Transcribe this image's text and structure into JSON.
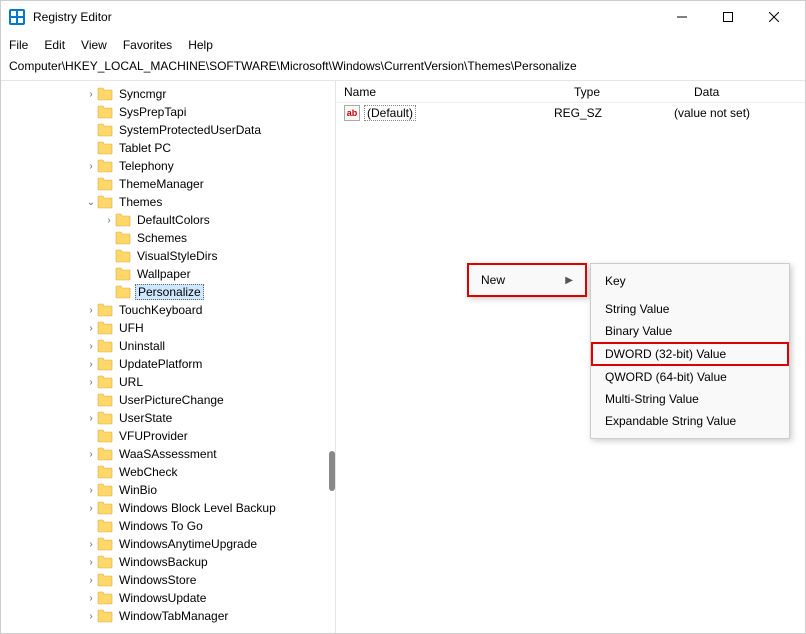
{
  "window": {
    "title": "Registry Editor"
  },
  "menubar": {
    "file": "File",
    "edit": "Edit",
    "view": "View",
    "favorites": "Favorites",
    "help": "Help"
  },
  "addressbar": "Computer\\HKEY_LOCAL_MACHINE\\SOFTWARE\\Microsoft\\Windows\\CurrentVersion\\Themes\\Personalize",
  "tree": [
    {
      "label": "Syncmgr",
      "depth": 5,
      "expand": ">"
    },
    {
      "label": "SysPrepTapi",
      "depth": 5,
      "expand": ""
    },
    {
      "label": "SystemProtectedUserData",
      "depth": 5,
      "expand": ""
    },
    {
      "label": "Tablet PC",
      "depth": 5,
      "expand": ""
    },
    {
      "label": "Telephony",
      "depth": 5,
      "expand": ">"
    },
    {
      "label": "ThemeManager",
      "depth": 5,
      "expand": ""
    },
    {
      "label": "Themes",
      "depth": 5,
      "expand": "v"
    },
    {
      "label": "DefaultColors",
      "depth": 6,
      "expand": ">"
    },
    {
      "label": "Schemes",
      "depth": 6,
      "expand": ""
    },
    {
      "label": "VisualStyleDirs",
      "depth": 6,
      "expand": ""
    },
    {
      "label": "Wallpaper",
      "depth": 6,
      "expand": ""
    },
    {
      "label": "Personalize",
      "depth": 6,
      "expand": "",
      "selected": true
    },
    {
      "label": "TouchKeyboard",
      "depth": 5,
      "expand": ">"
    },
    {
      "label": "UFH",
      "depth": 5,
      "expand": ">"
    },
    {
      "label": "Uninstall",
      "depth": 5,
      "expand": ">"
    },
    {
      "label": "UpdatePlatform",
      "depth": 5,
      "expand": ">"
    },
    {
      "label": "URL",
      "depth": 5,
      "expand": ">"
    },
    {
      "label": "UserPictureChange",
      "depth": 5,
      "expand": ""
    },
    {
      "label": "UserState",
      "depth": 5,
      "expand": ">"
    },
    {
      "label": "VFUProvider",
      "depth": 5,
      "expand": ""
    },
    {
      "label": "WaaSAssessment",
      "depth": 5,
      "expand": ">"
    },
    {
      "label": "WebCheck",
      "depth": 5,
      "expand": ""
    },
    {
      "label": "WinBio",
      "depth": 5,
      "expand": ">"
    },
    {
      "label": "Windows Block Level Backup",
      "depth": 5,
      "expand": ">"
    },
    {
      "label": "Windows To Go",
      "depth": 5,
      "expand": ""
    },
    {
      "label": "WindowsAnytimeUpgrade",
      "depth": 5,
      "expand": ">"
    },
    {
      "label": "WindowsBackup",
      "depth": 5,
      "expand": ">"
    },
    {
      "label": "WindowsStore",
      "depth": 5,
      "expand": ">"
    },
    {
      "label": "WindowsUpdate",
      "depth": 5,
      "expand": ">"
    },
    {
      "label": "WindowTabManager",
      "depth": 5,
      "expand": ">"
    }
  ],
  "list": {
    "headers": {
      "name": "Name",
      "type": "Type",
      "data": "Data"
    },
    "rows": [
      {
        "icon": "ab",
        "name": "(Default)",
        "type": "REG_SZ",
        "data": "(value not set)"
      }
    ]
  },
  "context_menu": {
    "new": "New",
    "submenu": {
      "key": "Key",
      "string": "String Value",
      "binary": "Binary Value",
      "dword": "DWORD (32-bit) Value",
      "qword": "QWORD (64-bit) Value",
      "multistring": "Multi-String Value",
      "expandable": "Expandable String Value"
    }
  }
}
